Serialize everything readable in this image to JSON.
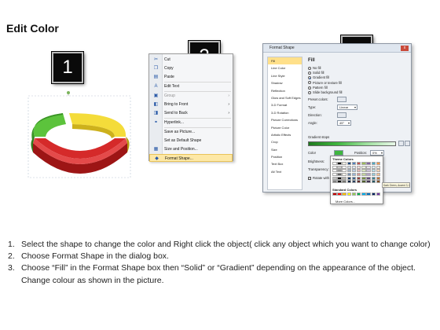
{
  "title": "Edit Color",
  "steps": [
    "1",
    "2",
    "3"
  ],
  "context_menu": {
    "items": [
      {
        "label": "Cut",
        "icon": "scissors-icon",
        "glyph": "✂",
        "disabled": false
      },
      {
        "label": "Copy",
        "icon": "copy-icon",
        "glyph": "❐",
        "disabled": false
      },
      {
        "label": "Paste",
        "icon": "paste-icon",
        "glyph": "▤",
        "disabled": false
      },
      {
        "label": "Edit Text",
        "icon": "edit-text-icon",
        "glyph": "A",
        "disabled": false
      },
      {
        "label": "Group",
        "icon": "group-icon",
        "glyph": "▣",
        "disabled": true,
        "submenu": true
      },
      {
        "label": "Bring to Front",
        "icon": "bring-front-icon",
        "glyph": "◧",
        "disabled": false,
        "submenu": true
      },
      {
        "label": "Send to Back",
        "icon": "send-back-icon",
        "glyph": "◨",
        "disabled": false,
        "submenu": true
      },
      {
        "label": "Hyperlink...",
        "icon": "hyperlink-icon",
        "glyph": "⚭",
        "disabled": false
      },
      {
        "label": "Save as Picture...",
        "icon": "",
        "glyph": "",
        "disabled": false
      },
      {
        "label": "Set as Default Shape",
        "icon": "",
        "glyph": "",
        "disabled": false
      },
      {
        "label": "Size and Position...",
        "icon": "size-position-icon",
        "glyph": "▦",
        "disabled": false
      },
      {
        "label": "Format Shape...",
        "icon": "format-shape-icon",
        "glyph": "◆",
        "disabled": false,
        "highlighted": true
      }
    ]
  },
  "format_dialog": {
    "title": "Format Shape",
    "close": "x",
    "categories": [
      "Fill",
      "Line Color",
      "Line Style",
      "Shadow",
      "Reflection",
      "Glow and Soft Edges",
      "3-D Format",
      "3-D Rotation",
      "Picture Corrections",
      "Picture Color",
      "Artistic Effects",
      "Crop",
      "Size",
      "Position",
      "Text Box",
      "Alt Text"
    ],
    "active_category": "Fill",
    "fill": {
      "heading": "Fill",
      "options": [
        {
          "label": "No fill",
          "selected": false
        },
        {
          "label": "Solid fill",
          "selected": false
        },
        {
          "label": "Gradient fill",
          "selected": true
        },
        {
          "label": "Picture or texture fill",
          "selected": false
        },
        {
          "label": "Pattern fill",
          "selected": false
        },
        {
          "label": "Slide background fill",
          "selected": false
        }
      ],
      "preset_colors_label": "Preset colors:",
      "type_label": "Type:",
      "type_value": "Linear",
      "direction_label": "Direction:",
      "angle_label": "Angle:",
      "angle_value": "45°",
      "gradient_stops_label": "Gradient stops",
      "color_label": "Color",
      "position_label": "Position:",
      "position_value": "0%",
      "brightness_label": "Brightness:",
      "transparency_label": "Transparency:",
      "rotate_label": "Rotate with shape"
    }
  },
  "color_picker": {
    "theme_heading": "Theme Colors",
    "standard_heading": "Standard Colors",
    "more_colors": "More Colors...",
    "tooltip": "Dark Green, Accent 3, Lighter 60%",
    "theme_row": [
      "#ffffff",
      "#000000",
      "#eeece1",
      "#1f497d",
      "#4f81bd",
      "#c0504d",
      "#9bbb59",
      "#8064a2",
      "#4bacc6",
      "#f79646"
    ],
    "standard_row": [
      "#c00000",
      "#ff0000",
      "#ffc000",
      "#ffff00",
      "#92d050",
      "#00b050",
      "#00b0f0",
      "#0070c0",
      "#002060",
      "#7030a0"
    ]
  },
  "instructions": [
    {
      "num": "1.",
      "text": "Select the shape to change the color and Right click the object( click any object which you want to change color)"
    },
    {
      "num": "2.",
      "text": "Choose Format Shape in the dialog box."
    },
    {
      "num": "3.",
      "text": "Choose “Fill” in the Format Shape box then “Solid” or “Gradient” depending on the appearance of the object. Change colour as shown in the picture."
    }
  ],
  "ring_colors": {
    "green": "#5cc33c",
    "yellow": "#f4dc3a",
    "red": "#d52a2a"
  }
}
